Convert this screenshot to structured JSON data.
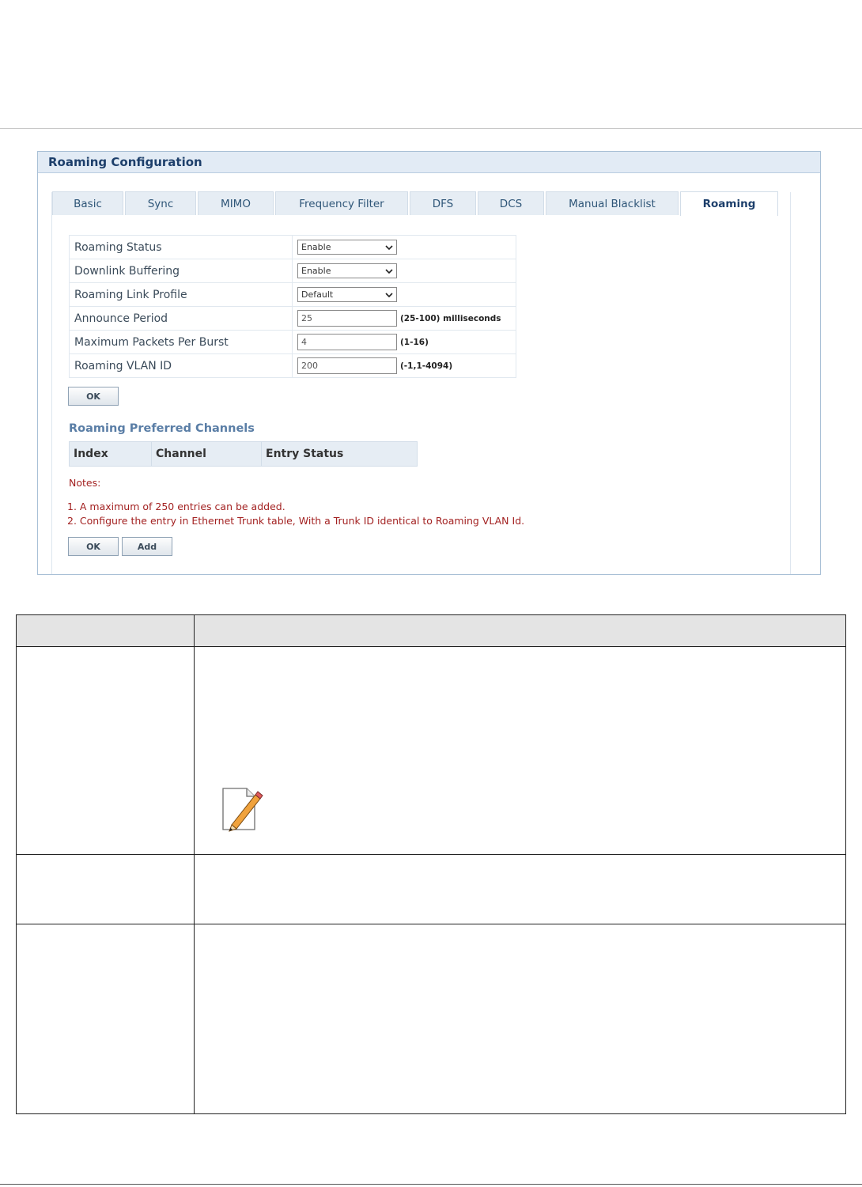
{
  "panel": {
    "title": "Roaming Configuration"
  },
  "tabs": [
    {
      "label": "Basic"
    },
    {
      "label": "Sync"
    },
    {
      "label": "MIMO"
    },
    {
      "label": "Frequency Filter"
    },
    {
      "label": "DFS"
    },
    {
      "label": "DCS"
    },
    {
      "label": "Manual Blacklist"
    },
    {
      "label": "Roaming",
      "active": true
    }
  ],
  "fields": {
    "roaming_status": {
      "label": "Roaming Status",
      "value": "Enable"
    },
    "downlink_buffering": {
      "label": "Downlink Buffering",
      "value": "Enable"
    },
    "roaming_link_profile": {
      "label": "Roaming Link Profile",
      "value": "Default"
    },
    "announce_period": {
      "label": "Announce Period",
      "value": "25",
      "range": "(25-100) milliseconds"
    },
    "max_packets_per_burst": {
      "label": "Maximum Packets Per Burst",
      "value": "4",
      "range": "(1-16)"
    },
    "roaming_vlan_id": {
      "label": "Roaming VLAN ID",
      "value": "200",
      "range": "(-1,1-4094)"
    }
  },
  "buttons": {
    "ok_label": "OK",
    "add_label": "Add"
  },
  "channels": {
    "title": "Roaming Preferred Channels",
    "columns": [
      "Index",
      "Channel",
      "Entry Status"
    ]
  },
  "notes": {
    "title": "Notes:",
    "items": [
      "1. A maximum of 250 entries can be added.",
      "2. Configure the entry in Ethernet Trunk table, With a Trunk ID identical to Roaming VLAN Id."
    ]
  },
  "icons": {
    "note": "note-pencil-icon",
    "dropdown": "chevron-down-icon"
  },
  "colors": {
    "header_bg": "#e2ebf5",
    "title": "#1d3f6b",
    "note_text": "#a32222",
    "subheading": "#5a7ea6"
  }
}
